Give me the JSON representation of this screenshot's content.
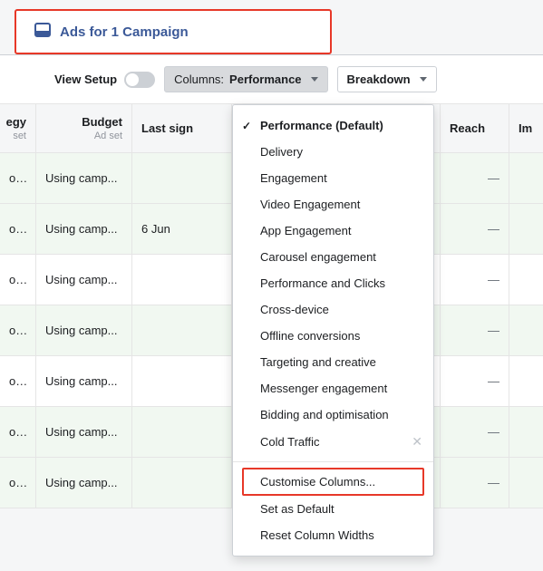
{
  "tab": {
    "label": "Ads for 1 Campaign"
  },
  "toolbar": {
    "view_setup_label": "View Setup",
    "columns_prefix": "Columns:",
    "columns_value": "Performance",
    "breakdown_label": "Breakdown"
  },
  "columns": {
    "strategy": {
      "header": "egy",
      "sub": "set"
    },
    "budget": {
      "header": "Budget",
      "sub": "Ad set"
    },
    "lastsign": {
      "header": "Last sign",
      "sub": ""
    },
    "reach": {
      "header": "Reach",
      "sub": ""
    },
    "impr": {
      "header": "Im",
      "sub": ""
    }
  },
  "rows": [
    {
      "strategy": "ost e...",
      "budget": "Using camp...",
      "lastsign": "",
      "reach": "—",
      "shaded": true
    },
    {
      "strategy": "ost e...",
      "budget": "Using camp...",
      "lastsign": "6 Jun",
      "reach": "—",
      "shaded": true
    },
    {
      "strategy": "ost e...",
      "budget": "Using camp...",
      "lastsign": "",
      "reach": "—",
      "shaded": false
    },
    {
      "strategy": "ost e...",
      "budget": "Using camp...",
      "lastsign": "",
      "reach": "—",
      "shaded": true
    },
    {
      "strategy": "ost e...",
      "budget": "Using camp...",
      "lastsign": "",
      "reach": "—",
      "shaded": false
    },
    {
      "strategy": "ost e...",
      "budget": "Using camp...",
      "lastsign": "",
      "reach": "—",
      "shaded": true
    },
    {
      "strategy": "ost e...",
      "budget": "Using camp...",
      "lastsign": "",
      "reach": "—",
      "shaded": true
    }
  ],
  "dropdown": {
    "presets": [
      {
        "label": "Performance (Default)",
        "checked": true,
        "closable": false
      },
      {
        "label": "Delivery",
        "checked": false,
        "closable": false
      },
      {
        "label": "Engagement",
        "checked": false,
        "closable": false
      },
      {
        "label": "Video Engagement",
        "checked": false,
        "closable": false
      },
      {
        "label": "App Engagement",
        "checked": false,
        "closable": false
      },
      {
        "label": "Carousel engagement",
        "checked": false,
        "closable": false
      },
      {
        "label": "Performance and Clicks",
        "checked": false,
        "closable": false
      },
      {
        "label": "Cross-device",
        "checked": false,
        "closable": false
      },
      {
        "label": "Offline conversions",
        "checked": false,
        "closable": false
      },
      {
        "label": "Targeting and creative",
        "checked": false,
        "closable": false
      },
      {
        "label": "Messenger engagement",
        "checked": false,
        "closable": false
      },
      {
        "label": "Bidding and optimisation",
        "checked": false,
        "closable": false
      },
      {
        "label": "Cold Traffic",
        "checked": false,
        "closable": true
      }
    ],
    "actions": [
      {
        "label": "Customise Columns...",
        "highlighted": true
      },
      {
        "label": "Set as Default",
        "highlighted": false
      },
      {
        "label": "Reset Column Widths",
        "highlighted": false
      }
    ]
  }
}
